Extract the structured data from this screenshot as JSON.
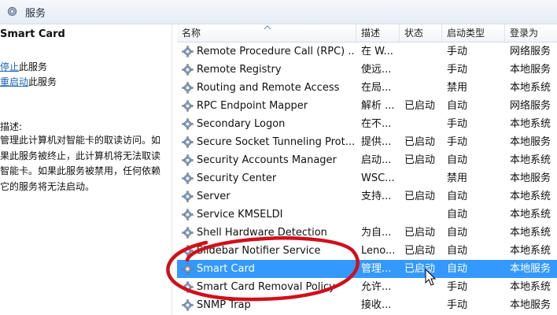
{
  "window": {
    "title": "服务"
  },
  "left_pane": {
    "service_name": "Smart Card",
    "actions": [
      {
        "link": "停止",
        "suffix": "此服务"
      },
      {
        "link": "重启动",
        "suffix": "此服务"
      }
    ],
    "description_label": "描述:",
    "description": "管理此计算机对智能卡的取读访问。如果此服务被终止，此计算机将无法取读智能卡。如果此服务被禁用，任何依赖它的服务将无法启动。"
  },
  "columns": [
    "名称",
    "描述",
    "状态",
    "启动类型",
    "登录为"
  ],
  "services": [
    {
      "name": "Remote Procedure Call (RPC) ...",
      "desc": "在 W...",
      "status": "",
      "startup": "手动",
      "logon": "网络服务"
    },
    {
      "name": "Remote Registry",
      "desc": "使远...",
      "status": "",
      "startup": "手动",
      "logon": "本地服务"
    },
    {
      "name": "Routing and Remote Access",
      "desc": "在局...",
      "status": "",
      "startup": "禁用",
      "logon": "本地系统"
    },
    {
      "name": "RPC Endpoint Mapper",
      "desc": "解析 ...",
      "status": "已启动",
      "startup": "自动",
      "logon": "网络服务"
    },
    {
      "name": "Secondary Logon",
      "desc": "在不...",
      "status": "",
      "startup": "手动",
      "logon": "本地系统"
    },
    {
      "name": "Secure Socket Tunneling Prot...",
      "desc": "提供...",
      "status": "已启动",
      "startup": "手动",
      "logon": "本地服务"
    },
    {
      "name": "Security Accounts Manager",
      "desc": "启动...",
      "status": "已启动",
      "startup": "自动",
      "logon": "本地系统"
    },
    {
      "name": "Security Center",
      "desc": "WSC...",
      "status": "",
      "startup": "禁用",
      "logon": "本地服务"
    },
    {
      "name": "Server",
      "desc": "支持...",
      "status": "已启动",
      "startup": "自动",
      "logon": "本地系统"
    },
    {
      "name": "Service KMSELDI",
      "desc": "",
      "status": "",
      "startup": "自动",
      "logon": "本地系统"
    },
    {
      "name": "Shell Hardware Detection",
      "desc": "为自...",
      "status": "已启动",
      "startup": "自动",
      "logon": "本地系统"
    },
    {
      "name": "Slidebar Notifier Service",
      "desc": "Leno...",
      "status": "已启动",
      "startup": "自动",
      "logon": "本地系统"
    },
    {
      "name": "Smart Card",
      "desc": "管理...",
      "status": "已启动",
      "startup": "自动",
      "logon": "本地服务",
      "selected": true
    },
    {
      "name": "Smart Card Removal Policy",
      "desc": "允许...",
      "status": "",
      "startup": "手动",
      "logon": "本地系统"
    },
    {
      "name": "SNMP Trap",
      "desc": "接收...",
      "status": "",
      "startup": "手动",
      "logon": "本地服务"
    }
  ],
  "colors": {
    "selection": "#3399ff",
    "link": "#1a63b8",
    "annotation": "#d0101a"
  },
  "icons": {
    "window": "services-gear-icon",
    "row": "gear-icon",
    "sort": "sort-ascending-icon",
    "cursor": "mouse-pointer-icon"
  }
}
